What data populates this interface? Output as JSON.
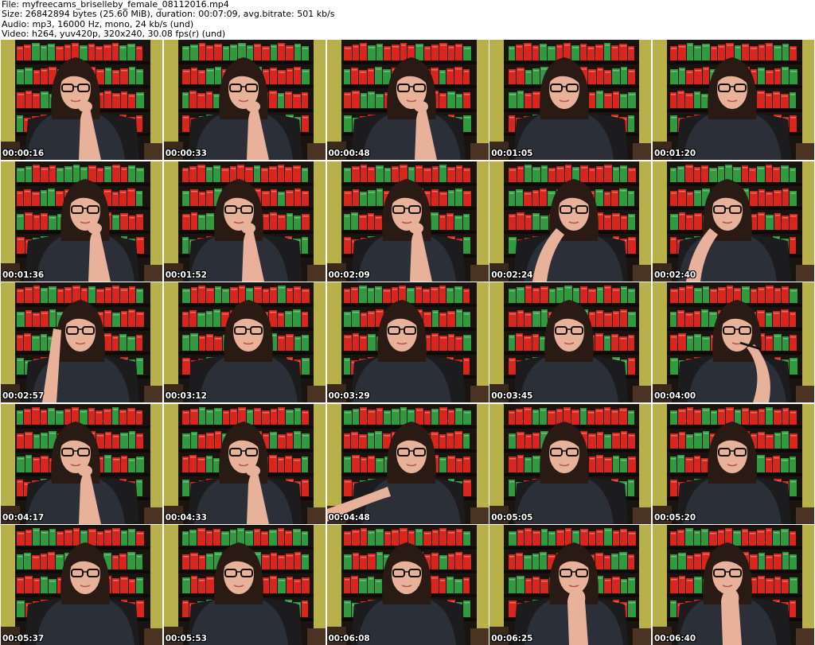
{
  "header": {
    "lines": [
      "File: myfreecams_briselleby_female_08112016.mp4",
      "Size: 26842894 bytes (25.60 MiB), duration: 00:07:09, avg.bitrate: 501 kb/s",
      "Audio: mp3, 16000 Hz, mono, 24 kb/s (und)",
      "Video: h264, yuv420p, 320x240, 30.08 fps(r) (und)"
    ]
  },
  "thumbnails": [
    {
      "timestamp": "00:00:16",
      "pose": "hand-chin"
    },
    {
      "timestamp": "00:00:33",
      "pose": "hand-chin"
    },
    {
      "timestamp": "00:00:48",
      "pose": "hand-chin"
    },
    {
      "timestamp": "00:01:05",
      "pose": "neutral"
    },
    {
      "timestamp": "00:01:20",
      "pose": "neutral"
    },
    {
      "timestamp": "00:01:36",
      "pose": "hand-chin"
    },
    {
      "timestamp": "00:01:52",
      "pose": "hand-chin"
    },
    {
      "timestamp": "00:02:09",
      "pose": "hand-chin"
    },
    {
      "timestamp": "00:02:24",
      "pose": "hand-hair"
    },
    {
      "timestamp": "00:02:40",
      "pose": "hand-hair"
    },
    {
      "timestamp": "00:02:57",
      "pose": "hand-raised"
    },
    {
      "timestamp": "00:03:12",
      "pose": "neutral"
    },
    {
      "timestamp": "00:03:29",
      "pose": "neutral"
    },
    {
      "timestamp": "00:03:45",
      "pose": "neutral"
    },
    {
      "timestamp": "00:04:00",
      "pose": "pen-mouth"
    },
    {
      "timestamp": "00:04:17",
      "pose": "hand-chin"
    },
    {
      "timestamp": "00:04:33",
      "pose": "hand-chin"
    },
    {
      "timestamp": "00:04:48",
      "pose": "arm-out"
    },
    {
      "timestamp": "00:05:05",
      "pose": "neutral"
    },
    {
      "timestamp": "00:05:20",
      "pose": "neutral"
    },
    {
      "timestamp": "00:05:37",
      "pose": "neutral"
    },
    {
      "timestamp": "00:05:53",
      "pose": "neutral"
    },
    {
      "timestamp": "00:06:08",
      "pose": "neutral"
    },
    {
      "timestamp": "00:06:25",
      "pose": "fist-mouth"
    },
    {
      "timestamp": "00:06:40",
      "pose": "fist-mouth"
    }
  ],
  "colors": {
    "wall": "#b8b04a",
    "shelf": "#1a1410",
    "book_red": "#d8261c",
    "book_green": "#2f9a3e",
    "shirt": "#2b3038",
    "hair": "#2a1a14",
    "skin": "#e8b29a",
    "chair": "#1c1c1e"
  }
}
